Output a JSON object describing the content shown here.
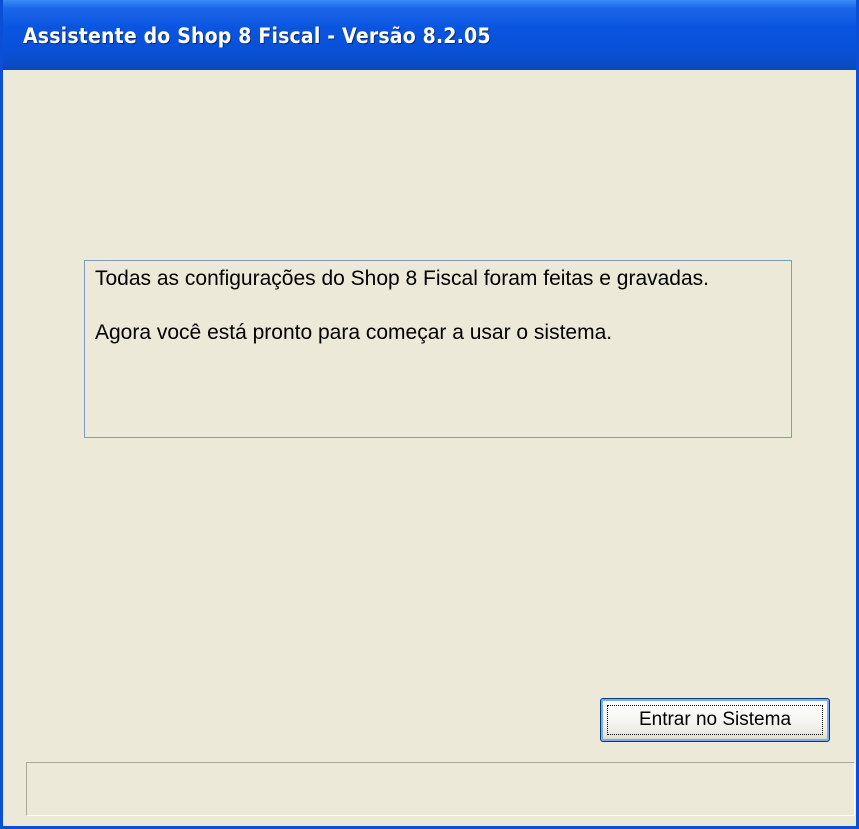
{
  "window": {
    "title": "Assistente do Shop 8 Fiscal - Versão 8.2.05"
  },
  "message": {
    "line1": "Todas as configurações do Shop 8 Fiscal foram feitas e gravadas.",
    "line2": "Agora você está pronto para começar a usar o sistema."
  },
  "actions": {
    "enter_label": "Entrar no Sistema"
  },
  "statusbar": {
    "text": ""
  },
  "colors": {
    "titlebar": "#0a55e0",
    "background": "#ece9d8",
    "panel_border": "#7f9db9",
    "button_border": "#003c74"
  }
}
